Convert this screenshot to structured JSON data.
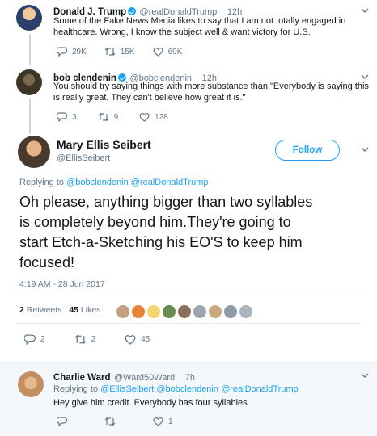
{
  "tweet1": {
    "name": "Donald J. Trump",
    "handle": "@realDonaldTrump",
    "dot": "·",
    "time": "12h",
    "text_l1": "Some of the Fake News Media likes to say that I am not totally engaged in",
    "text_l2": "healthcare. Wrong, I know the subject well & want victory for U.S.",
    "replies": "29K",
    "retweets": "15K",
    "likes": "69K"
  },
  "tweet2": {
    "name": "bob clendenin",
    "handle": "@bobclendenin",
    "dot": "·",
    "time": "12h",
    "text_l1": "You should try saying things with more substance than \"Everybody is saying this",
    "text_l2": "is really great. They can't believe how great it is.\"",
    "replies": "3",
    "retweets": "9",
    "likes": "128"
  },
  "main": {
    "name": "Mary Ellis Seibert",
    "handle": "@EllisSeibert",
    "follow_label": "Follow",
    "replying_to": "Replying to",
    "mention1": "@bobclendenin",
    "mention2": "@realDonaldTrump",
    "text_l1": "Oh please, anything bigger than two syllables",
    "text_l2": "is completely beyond him.They're going to",
    "text_l3": "start Etch-a-Sketching his EO'S to keep him",
    "text_l4": "focused!",
    "timestamp": "4:19 AM - 28 Jun 2017",
    "retweet_count": "2",
    "retweet_label": "Retweets",
    "like_count": "45",
    "like_label": "Likes",
    "replies": "2",
    "retweets": "2",
    "likes": "45"
  },
  "reply": {
    "name": "Charlie Ward",
    "handle": "@Ward50Ward",
    "dot": "·",
    "time": "7h",
    "replying_to": "Replying to",
    "mention1": "@EllisSeibert",
    "mention2": "@bobclendenin",
    "mention3": "@realDonaldTrump",
    "text": "Hey give him credit. Everybody has four syllables",
    "likes": "1"
  },
  "colors": {
    "accent": "#1da1f2",
    "muted": "#657786",
    "text": "#14171a",
    "divider": "#e6ecf0"
  },
  "icons": [
    "reply-icon",
    "retweet-icon",
    "heart-icon",
    "verified-icon",
    "chevron-down-icon"
  ]
}
